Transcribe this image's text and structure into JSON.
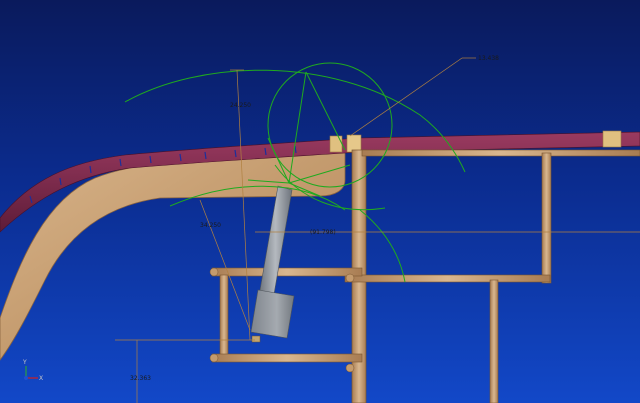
{
  "viewport": {
    "background_top": "#0a1a5c",
    "background_bottom": "#1248c8"
  },
  "dimensions": {
    "d1": "13.438",
    "d2": "24.250",
    "d3": "34.250",
    "d4": "(91.798)",
    "d5": "32.363"
  },
  "triad": {
    "x_label": "X",
    "y_label": "Y",
    "z_label": "Z"
  },
  "colors": {
    "wood": "#c9a27a",
    "wood_dark": "#a67c52",
    "hull_skin": "#7a2a4a",
    "sketch_green": "#1faa1f",
    "dimension_line": "#b08040",
    "actuator": "#8a8f96"
  }
}
